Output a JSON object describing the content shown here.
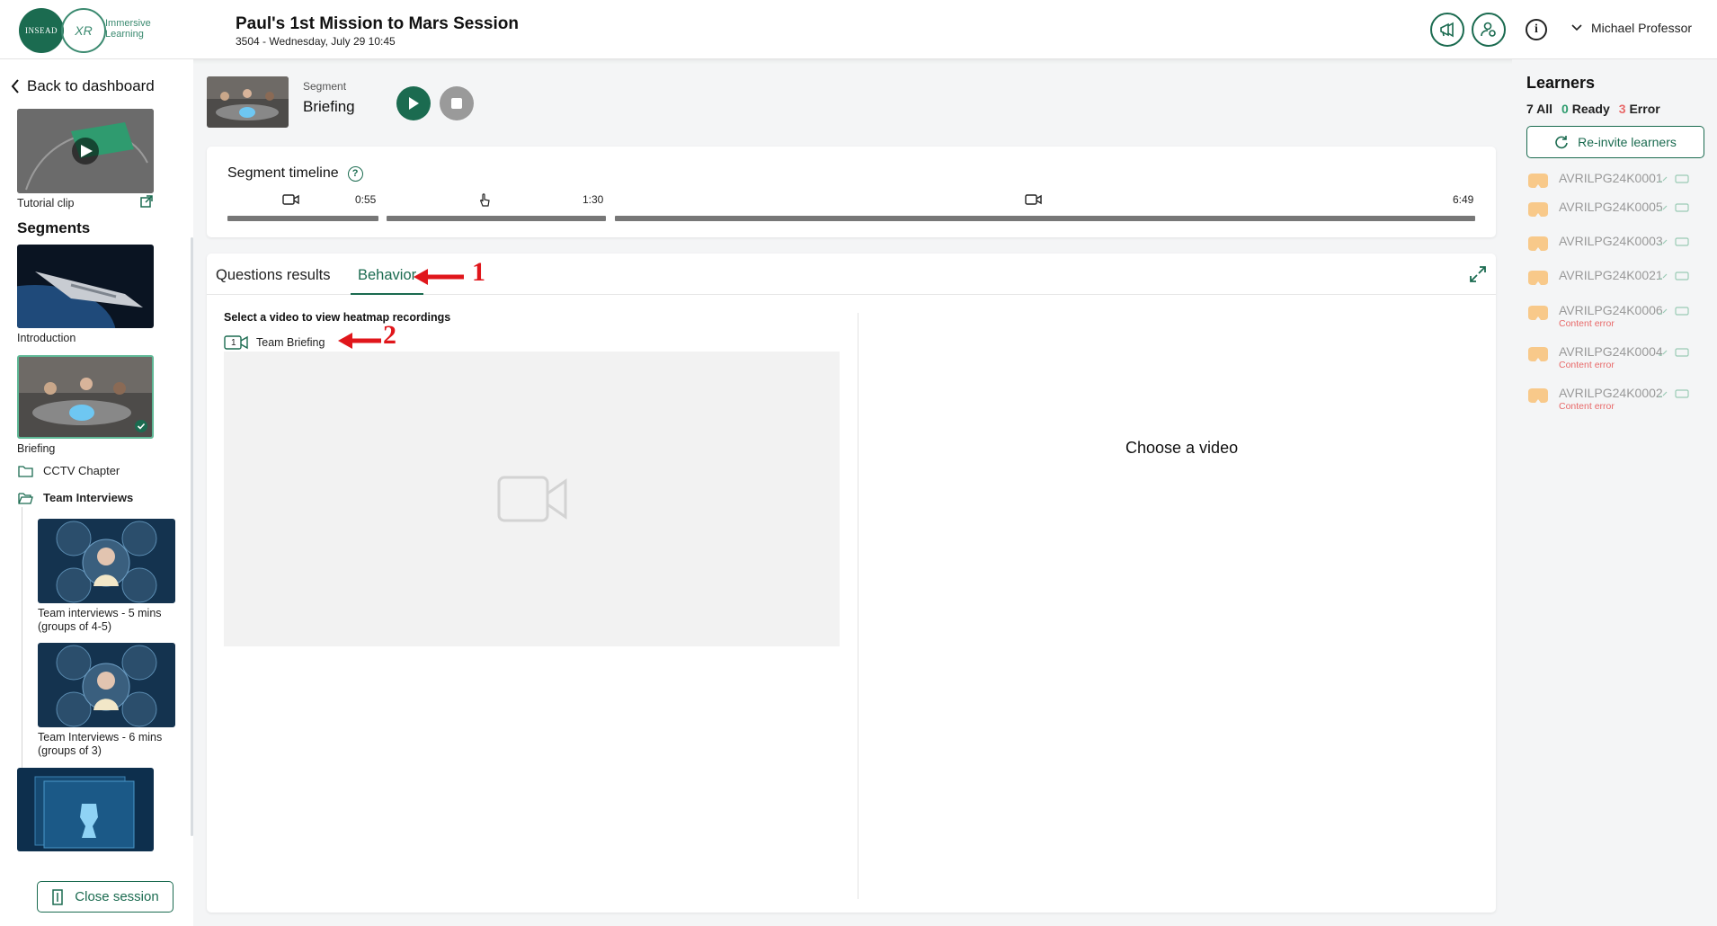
{
  "header": {
    "logo_left": "INSEAD",
    "logo_ring": "XR",
    "logo_text_1": "Immersive",
    "logo_text_2": "Learning",
    "title": "Paul's 1st Mission to Mars Session",
    "subtitle": "3504 - Wednesday, July 29  10:45",
    "user_name": "Michael Professor"
  },
  "sidebar": {
    "back_label": "Back to dashboard",
    "tutorial_label": "Tutorial clip",
    "segments_title": "Segments",
    "segments": [
      {
        "label": "Introduction"
      },
      {
        "label": "Briefing"
      }
    ],
    "folders": [
      {
        "label": "CCTV Chapter"
      },
      {
        "label": "Team Interviews"
      }
    ],
    "interviews": [
      {
        "label_1": "Team interviews - 5 mins",
        "label_2": "(groups of 4-5)"
      },
      {
        "label_1": "Team Interviews - 6 mins",
        "label_2": "(groups of 3)"
      }
    ],
    "close_label": "Close session"
  },
  "segment_bar": {
    "caption": "Segment",
    "name": "Briefing"
  },
  "timeline": {
    "title": "Segment timeline",
    "help": "?",
    "times": [
      "0:55",
      "1:30",
      "6:49"
    ]
  },
  "tabs": {
    "questions": "Questions results",
    "behavior": "Behavior"
  },
  "annotations": [
    "1",
    "2"
  ],
  "behavior": {
    "select_text": "Select a video to view heatmap recordings",
    "video_badge": "1",
    "video_label": "Team Briefing",
    "choose_text": "Choose a video"
  },
  "learners": {
    "title": "Learners",
    "count_all": "7 All",
    "count_ready_num": "0",
    "count_ready_label": "Ready",
    "count_error_num": "3",
    "count_error_label": "Error",
    "reinvite_label": "Re-invite learners",
    "items": [
      {
        "id": "AVRILPG24K0001",
        "error": ""
      },
      {
        "id": "AVRILPG24K0005",
        "error": ""
      },
      {
        "id": "AVRILPG24K0003",
        "error": ""
      },
      {
        "id": "AVRILPG24K0021",
        "error": ""
      },
      {
        "id": "AVRILPG24K0006",
        "error": "Content error"
      },
      {
        "id": "AVRILPG24K0004",
        "error": "Content error"
      },
      {
        "id": "AVRILPG24K0002",
        "error": "Content error"
      }
    ]
  },
  "colors": {
    "accent": "#1b6b50",
    "error": "#e86a6a",
    "annotation": "#e0161b",
    "headset": "#f8c98a"
  }
}
